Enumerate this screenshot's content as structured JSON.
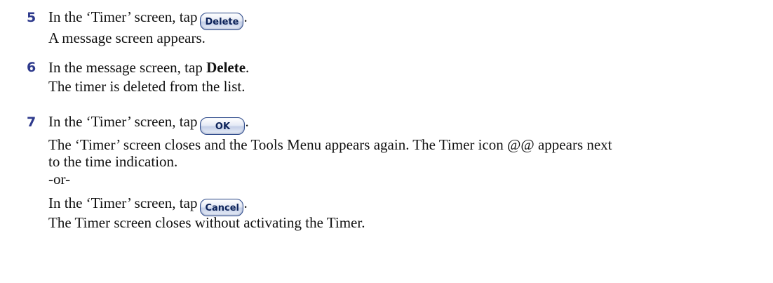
{
  "steps": [
    {
      "number": "5",
      "lines": [
        "In the ‘Timer’ screen, tap",
        "A message screen appears."
      ],
      "button": "Delete"
    },
    {
      "number": "6",
      "lines_a": "In the message screen, tap ",
      "bold": "Delete",
      "lines_b": ".",
      "line2": "The timer is deleted from the list."
    },
    {
      "number": "7",
      "line1": "In the ‘Timer’ screen, tap",
      "button": "OK",
      "line2": "The ‘Timer’ screen closes and the Tools Menu appears again. The Timer icon @@ appears next",
      "line3": "to the time indication.",
      "or": "-or-",
      "line4": "In the ‘Timer’ screen, tap",
      "button2": "Cancel",
      "line5": "The Timer screen closes without activating the Timer."
    }
  ],
  "period": "."
}
